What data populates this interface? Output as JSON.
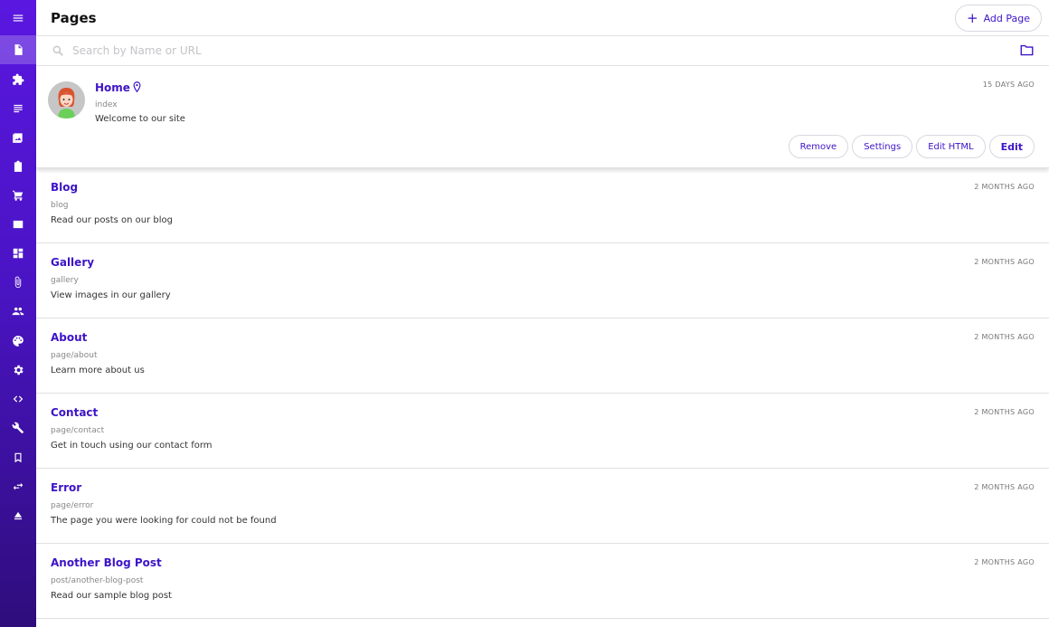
{
  "header": {
    "title": "Pages",
    "add_button_label": "Add Page"
  },
  "search": {
    "placeholder": "Search by Name or URL"
  },
  "sidebar": {
    "items": [
      {
        "icon": "menu-icon"
      },
      {
        "icon": "pages-icon",
        "active": true
      },
      {
        "icon": "extension-icon"
      },
      {
        "icon": "list-icon"
      },
      {
        "icon": "image-icon"
      },
      {
        "icon": "clipboard-icon"
      },
      {
        "icon": "cart-icon"
      },
      {
        "icon": "mail-icon"
      },
      {
        "icon": "dashboard-icon"
      },
      {
        "icon": "attachment-icon"
      },
      {
        "icon": "people-icon"
      },
      {
        "icon": "palette-icon"
      },
      {
        "icon": "gear-icon"
      },
      {
        "icon": "code-icon"
      },
      {
        "icon": "wrench-icon"
      },
      {
        "icon": "bookmark-icon"
      },
      {
        "icon": "swap-icon"
      },
      {
        "icon": "eject-icon"
      }
    ]
  },
  "pages": [
    {
      "name": "Home",
      "url": "index",
      "description": "Welcome to our site",
      "date": "15 DAYS AGO",
      "actions": {
        "remove": "Remove",
        "settings": "Settings",
        "edit_html": "Edit HTML",
        "edit": "Edit"
      }
    },
    {
      "name": "Blog",
      "url": "blog",
      "description": "Read our posts on our blog",
      "date": "2 MONTHS AGO"
    },
    {
      "name": "Gallery",
      "url": "gallery",
      "description": "View images in our gallery",
      "date": "2 MONTHS AGO"
    },
    {
      "name": "About",
      "url": "page/about",
      "description": "Learn more about us",
      "date": "2 MONTHS AGO"
    },
    {
      "name": "Contact",
      "url": "page/contact",
      "description": "Get in touch using our contact form",
      "date": "2 MONTHS AGO"
    },
    {
      "name": "Error",
      "url": "page/error",
      "description": "The page you were looking for could not be found",
      "date": "2 MONTHS AGO"
    },
    {
      "name": "Another Blog Post",
      "url": "post/another-blog-post",
      "description": "Read our sample blog post",
      "date": "2 MONTHS AGO"
    }
  ],
  "colors": {
    "accent": "#3d14c8",
    "sidebar_top": "#5a17e0",
    "sidebar_bottom": "#2f0d7c"
  }
}
